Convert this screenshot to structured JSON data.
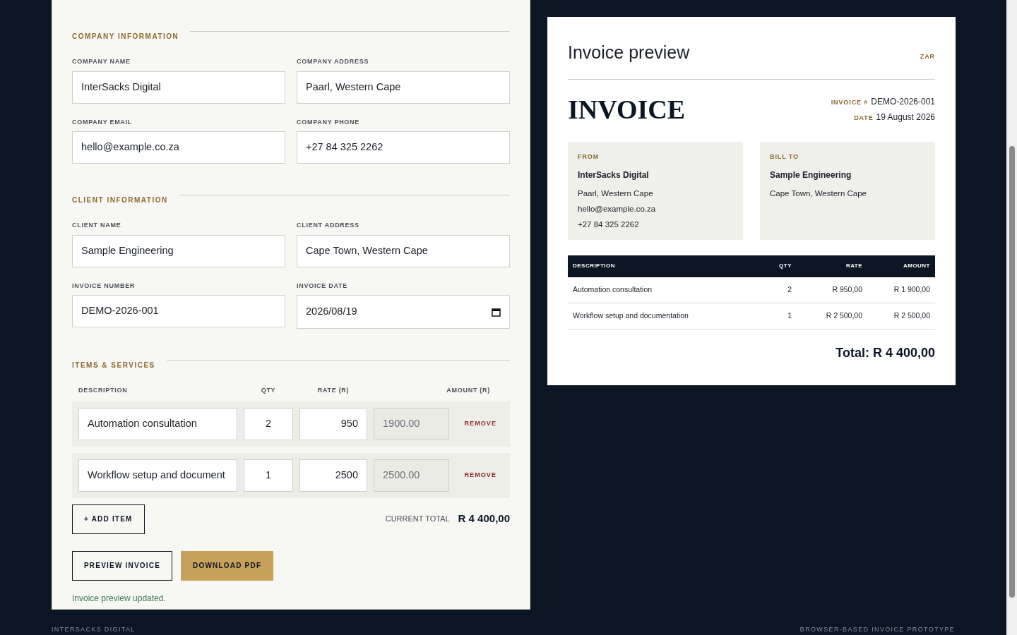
{
  "form": {
    "sections": [
      {
        "heading": "COMPANY INFORMATION",
        "fields": [
          {
            "label": "COMPANY NAME",
            "value": "InterSacks Digital",
            "kind": "text"
          },
          {
            "label": "COMPANY ADDRESS",
            "value": "Paarl, Western Cape",
            "kind": "text"
          },
          {
            "label": "COMPANY EMAIL",
            "value": "hello@example.co.za",
            "kind": "text"
          },
          {
            "label": "COMPANY PHONE",
            "value": "+27 84 325 2262",
            "kind": "text"
          }
        ]
      },
      {
        "heading": "CLIENT INFORMATION",
        "fields": [
          {
            "label": "CLIENT NAME",
            "value": "Sample Engineering",
            "kind": "text"
          },
          {
            "label": "CLIENT ADDRESS",
            "value": "Cape Town, Western Cape",
            "kind": "text"
          },
          {
            "label": "INVOICE NUMBER",
            "value": "DEMO-2026-001",
            "kind": "text"
          },
          {
            "label": "INVOICE DATE",
            "value": "2026/08/19",
            "kind": "date"
          }
        ]
      }
    ],
    "items": {
      "heading": "ITEMS & SERVICES",
      "columns": [
        "DESCRIPTION",
        "QTY",
        "RATE (R)",
        "AMOUNT (R)"
      ],
      "rows": [
        {
          "description": "Automation consultation",
          "qty": "2",
          "rate": "950",
          "amount": "1900.00",
          "remove": "REMOVE"
        },
        {
          "description": "Workflow setup and document",
          "qty": "1",
          "rate": "2500",
          "amount": "2500.00",
          "remove": "REMOVE"
        }
      ],
      "add_button": "+ ADD ITEM",
      "total_label": "CURRENT TOTAL",
      "total": "R 4 400,00"
    },
    "buttons": [
      {
        "label": "PREVIEW INVOICE",
        "kind": "outline"
      },
      {
        "label": "DOWNLOAD PDF",
        "kind": "primary"
      }
    ],
    "status": "Invoice preview updated."
  },
  "preview": {
    "title": "Invoice preview",
    "currency": "ZAR",
    "heading": "INVOICE",
    "meta": [
      {
        "label": "INVOICE #",
        "value": "DEMO-2026-001"
      },
      {
        "label": "DATE",
        "value": "19 August 2026"
      }
    ],
    "parties": [
      {
        "label": "FROM",
        "name": "InterSacks Digital",
        "lines": [
          "Paarl, Western Cape",
          "hello@example.co.za",
          "+27 84 325 2262"
        ]
      },
      {
        "label": "BILL TO",
        "name": "Sample Engineering",
        "lines": [
          "Cape Town, Western Cape"
        ]
      }
    ],
    "table": {
      "columns": [
        "DESCRIPTION",
        "QTY",
        "RATE",
        "AMOUNT"
      ],
      "rows": [
        [
          "Automation consultation",
          "2",
          "R 950,00",
          "R 1 900,00"
        ],
        [
          "Workflow setup and documentation",
          "1",
          "R 2 500,00",
          "R 2 500,00"
        ]
      ]
    },
    "total": "Total: R 4 400,00"
  },
  "footer": {
    "left": "INTERSACKS DIGITAL",
    "right": "BROWSER-BASED INVOICE PROTOTYPE"
  }
}
